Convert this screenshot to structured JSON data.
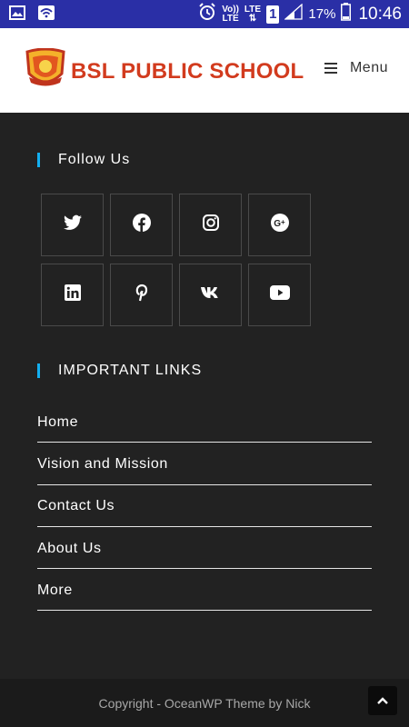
{
  "status_bar": {
    "volte_label": "Vo))",
    "lte_label": "LTE",
    "lte2_label": "LTE",
    "sim_label": "1",
    "battery": "17%",
    "time": "10:46"
  },
  "header": {
    "school_name": "BSL PUBLIC SCHOOL",
    "menu_label": "Menu"
  },
  "follow": {
    "title": "Follow Us",
    "icons": [
      "twitter-icon",
      "facebook-icon",
      "instagram-icon",
      "google-plus-icon",
      "linkedin-icon",
      "pinterest-icon",
      "vk-icon",
      "youtube-icon"
    ]
  },
  "important_links": {
    "title": "IMPORTANT LINKS",
    "items": [
      "Home",
      "Vision and Mission",
      "Contact Us",
      "About Us",
      "More"
    ]
  },
  "footer": {
    "copyright": "Copyright - OceanWP Theme by Nick"
  },
  "colors": {
    "status_bar": "#2a2fa6",
    "accent": "#13aff0",
    "school_name": "#d23b1e",
    "background": "#222222"
  }
}
